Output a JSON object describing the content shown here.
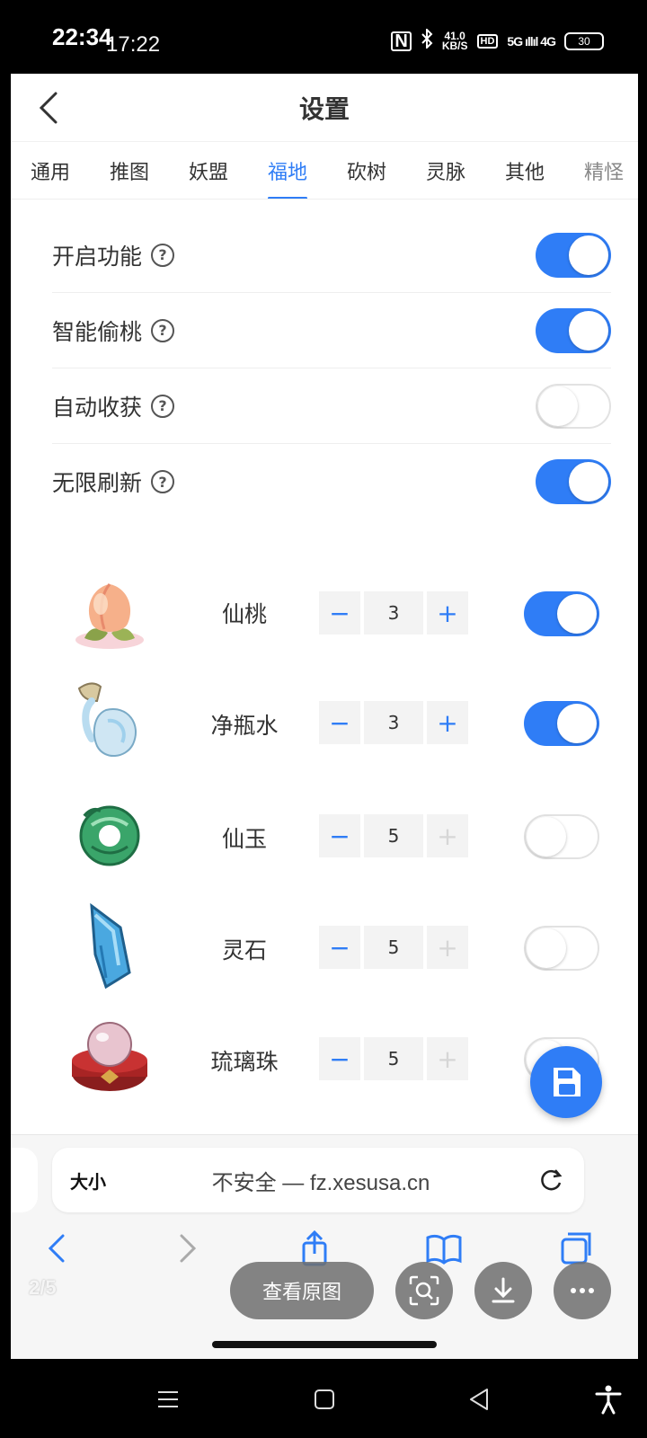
{
  "outer_status": {
    "time_primary": "22:34",
    "time_secondary": "17:22",
    "nfc": "N",
    "net_speed_value": "41.0",
    "net_speed_unit": "KB/S",
    "hd": "HD",
    "signal": "5G ıllıl 4G",
    "battery": "30"
  },
  "header": {
    "title": "设置"
  },
  "tabs": [
    {
      "label": "通用"
    },
    {
      "label": "推图"
    },
    {
      "label": "妖盟"
    },
    {
      "label": "福地",
      "active": true
    },
    {
      "label": "砍树"
    },
    {
      "label": "灵脉"
    },
    {
      "label": "其他"
    },
    {
      "label": "精怪"
    }
  ],
  "settings": [
    {
      "label": "开启功能",
      "enabled": true
    },
    {
      "label": "智能偷桃",
      "enabled": true
    },
    {
      "label": "自动收获",
      "enabled": false
    },
    {
      "label": "无限刷新",
      "enabled": true
    }
  ],
  "items": [
    {
      "name": "仙桃",
      "icon": "peach-icon",
      "quantity": "3",
      "enabled": true
    },
    {
      "name": "净瓶水",
      "icon": "vase-water-icon",
      "quantity": "3",
      "enabled": true
    },
    {
      "name": "仙玉",
      "icon": "jade-icon",
      "quantity": "5",
      "enabled": false
    },
    {
      "name": "灵石",
      "icon": "spirit-stone-icon",
      "quantity": "5",
      "enabled": false
    },
    {
      "name": "琉璃珠",
      "icon": "glass-bead-icon",
      "quantity": "5",
      "enabled": false
    }
  ],
  "browser": {
    "text_size_label": "大小",
    "url": "不安全 — fz.xesusa.cn"
  },
  "viewer": {
    "counter": "2/5",
    "view_original_label": "查看原图"
  },
  "colors": {
    "accent": "#2f7df6",
    "toggle_off_border": "#e2e2e2"
  }
}
